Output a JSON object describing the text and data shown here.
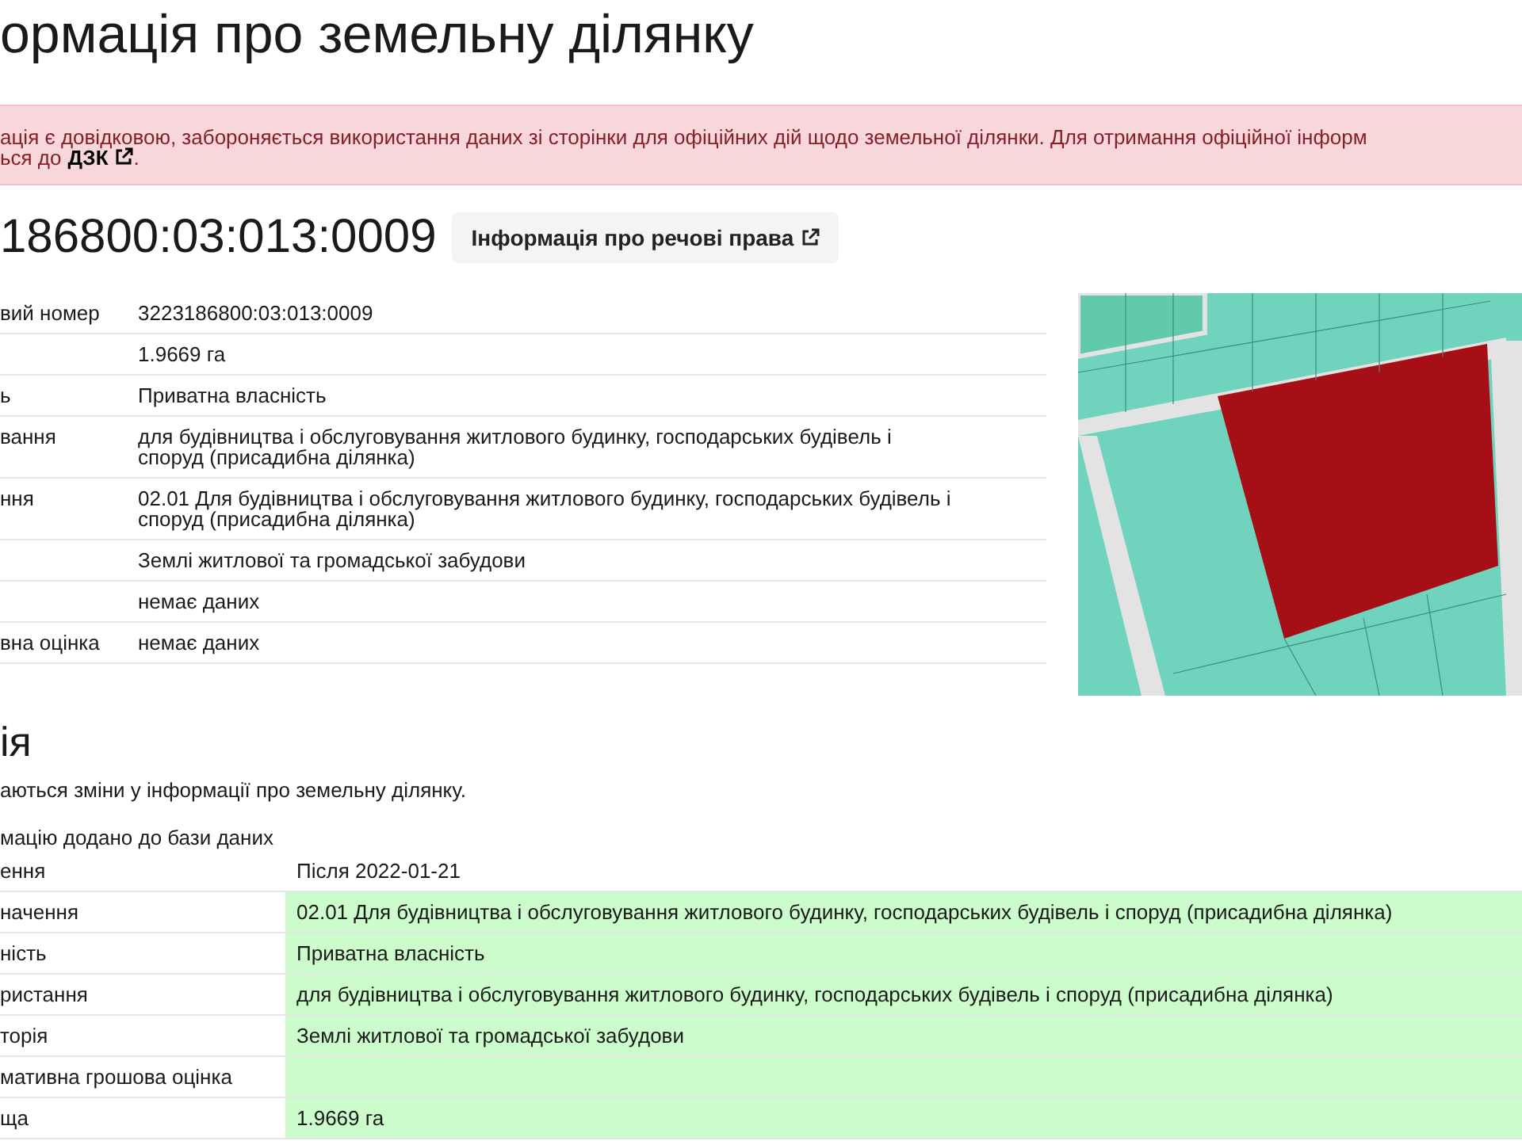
{
  "page_title": "ормація про земельну ділянку",
  "notice": {
    "text": "ація є довідковою, забороняється використання даних зі сторінки для офіційних дій щодо земельної ділянки. Для отримання офіційної інформ",
    "text_line2": "ься до",
    "link": "ДЗК",
    "tail": "."
  },
  "cadastral_number": "186800:03:013:0009",
  "rights_button": "Інформація про речові права",
  "details": [
    {
      "label": "вий номер",
      "value": "3223186800:03:013:0009"
    },
    {
      "value": "1.9669 га"
    },
    {
      "label": "ь",
      "value": "Приватна власність"
    },
    {
      "label": "вання",
      "value": "для будівництва і обслуговування житлового будинку, господарських будівель і споруд (присадибна ділянка)"
    },
    {
      "label": "ння",
      "value": "02.01 Для будівництва і обслуговування житлового будинку, господарських будівель і споруд (присадибна ділянка)"
    },
    {
      "value": "Землі житлової та громадської забудови"
    },
    {
      "value": "немає даних"
    },
    {
      "label": "вна оцінка",
      "value": "немає даних"
    }
  ],
  "history": {
    "title": "ія",
    "description": "аються зміни у інформації про земельну ділянку.",
    "entry_title": "мацію додано до бази даних",
    "rows": [
      {
        "label": "ення",
        "value": "Після 2022-01-21",
        "highlighted": false
      },
      {
        "label": "начення",
        "value": "02.01 Для будівництва і обслуговування житлового будинку, господарських будівель і споруд (присадибна ділянка)",
        "highlighted": true
      },
      {
        "label": "ність",
        "value": "Приватна власність",
        "highlighted": true
      },
      {
        "label": "ристання",
        "value": "для будівництва і обслуговування житлового будинку, господарських будівель і споруд (присадибна ділянка)",
        "highlighted": true
      },
      {
        "label": "торія",
        "value": "Землі житлової та громадської забудови",
        "highlighted": true
      },
      {
        "label": "мативна грошова оцінка",
        "highlighted": true
      },
      {
        "label": "ща",
        "value": "1.9669 га",
        "highlighted": true
      }
    ]
  }
}
